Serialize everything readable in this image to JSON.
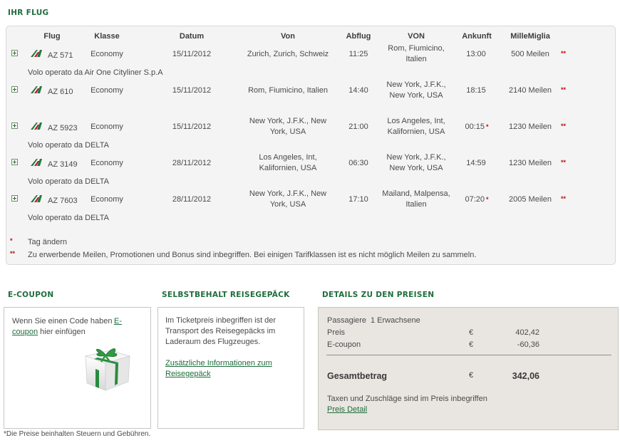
{
  "flight_section": {
    "title": "IHR FLUG",
    "headers": {
      "flug": "Flug",
      "klasse": "Klasse",
      "datum": "Datum",
      "von": "Von",
      "abflug": "Abflug",
      "nach": "VON",
      "ankunft": "Ankunft",
      "meilen": "MilleMiglia"
    },
    "flights": [
      {
        "number": "AZ 571",
        "class": "Economy",
        "date": "15/11/2012",
        "from": "Zurich, Zurich, Schweiz",
        "departure": "11:25",
        "to": "Rom, Fiumicino, Italien",
        "arrival": "13:00",
        "arrival_flag": "",
        "miles": "500 Meilen",
        "miles_flag": "**",
        "operated_by": "Volo operato da Air One Cityliner S.p.A"
      },
      {
        "number": "AZ 610",
        "class": "Economy",
        "date": "15/11/2012",
        "from": "Rom, Fiumicino, Italien",
        "departure": "14:40",
        "to": "New York, J.F.K., New York, USA",
        "arrival": "18:15",
        "arrival_flag": "",
        "miles": "2140 Meilen",
        "miles_flag": "**",
        "operated_by": ""
      },
      {
        "number": "AZ 5923",
        "class": "Economy",
        "date": "15/11/2012",
        "from": "New York, J.F.K., New York, USA",
        "departure": "21:00",
        "to": "Los Angeles, Int, Kalifornien, USA",
        "arrival": "00:15",
        "arrival_flag": "*",
        "miles": "1230 Meilen",
        "miles_flag": "**",
        "operated_by": "Volo operato da DELTA"
      },
      {
        "number": "AZ 3149",
        "class": "Economy",
        "date": "28/11/2012",
        "from": "Los Angeles, Int, Kalifornien, USA",
        "departure": "06:30",
        "to": "New York, J.F.K., New York, USA",
        "arrival": "14:59",
        "arrival_flag": "",
        "miles": "1230 Meilen",
        "miles_flag": "**",
        "operated_by": "Volo operato da DELTA"
      },
      {
        "number": "AZ 7603",
        "class": "Economy",
        "date": "28/11/2012",
        "from": "New York, J.F.K., New York, USA",
        "departure": "17:10",
        "to": "Mailand, Malpensa, Italien",
        "arrival": "07:20",
        "arrival_flag": "*",
        "miles": "2005 Meilen",
        "miles_flag": "**",
        "operated_by": "Volo operato da DELTA"
      }
    ],
    "notes": [
      {
        "marker": "*",
        "text": "Tag ändern"
      },
      {
        "marker": "**",
        "text": "Zu erwerbende Meilen, Promotionen und Bonus sind inbegriffen. Bei einigen Tarifklassen ist es nicht möglich Meilen zu sammeln."
      }
    ]
  },
  "ecoupon": {
    "title": "E-COUPON",
    "text": "Wenn Sie einen Code haben",
    "link": "E-coupon",
    "link_a": "E-",
    "link_b": "coupon",
    "text_after": "hier einfügen"
  },
  "baggage": {
    "title": "SELBSTBEHALT REISEGEPÄCK",
    "text": "Im Ticketpreis inbegriffen ist der Transport des Reisegepäcks im Laderaum des Flugzeuges.",
    "link_line1": "Zusätzliche Informationen zum",
    "link_line2": "Reisegepäck"
  },
  "prices": {
    "title": "DETAILS ZU DEN PREISEN",
    "passengers_label": "Passagiere",
    "passengers_value": "1 Erwachsene",
    "rows": [
      {
        "label": "Preis",
        "currency": "€",
        "amount": "402,42"
      },
      {
        "label": "E-coupon",
        "currency": "€",
        "amount": "-60,36"
      }
    ],
    "total_label": "Gesamtbetrag",
    "total_currency": "€",
    "total_amount": "342,06",
    "taxes_note": "Taxen und Zuschläge sind im Preis inbegriffen",
    "detail_link": "Preis Detail"
  },
  "footnote": "*Die Preise beinhalten Steuern und Gebühren.",
  "colors": {
    "accent": "#1f6d3c",
    "star": "#bb1111",
    "panel": "#f4f4f4",
    "price_box": "#e9e6e1"
  }
}
